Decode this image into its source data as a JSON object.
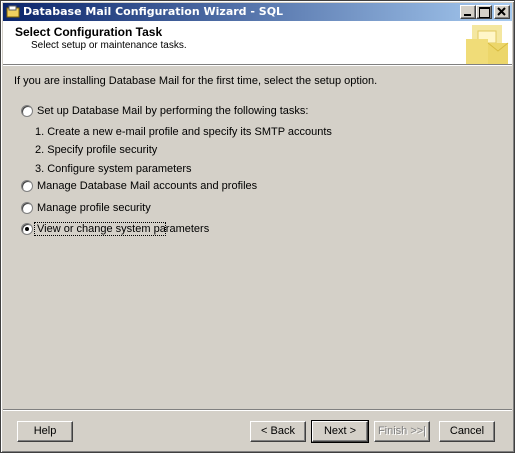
{
  "window": {
    "title": "Database Mail Configuration Wizard - SQL"
  },
  "header": {
    "title": "Select Configuration Task",
    "subtitle": "Select setup or maintenance tasks."
  },
  "content": {
    "intro": "If you are installing Database Mail for the first time, select the setup option.",
    "options": [
      {
        "label": "Set up Database Mail by performing the following tasks:",
        "checked": false
      },
      {
        "label": "Manage Database Mail accounts and profiles",
        "checked": false
      },
      {
        "label": "Manage profile security",
        "checked": false
      },
      {
        "label": "View or change system parameters",
        "checked": true
      }
    ],
    "setup_steps": [
      "1. Create a new e-mail profile and specify its SMTP accounts",
      "2. Specify profile security",
      "3. Configure system parameters"
    ]
  },
  "buttons": {
    "help": "Help",
    "back": "< Back",
    "next": "Next >",
    "finish": "Finish >>|",
    "cancel": "Cancel"
  },
  "icons": {
    "app": "wizard-app-icon",
    "header_art": "database-mail-graphic"
  }
}
